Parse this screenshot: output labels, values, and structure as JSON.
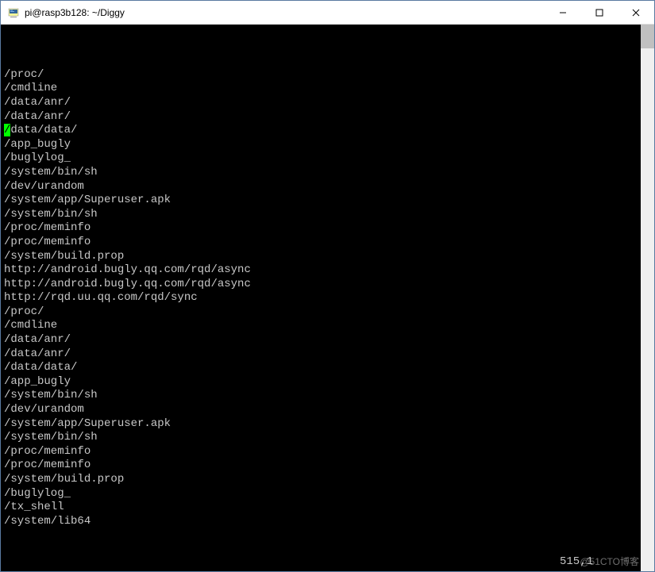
{
  "window": {
    "title": "pi@rasp3b128: ~/Diggy",
    "icon": "putty-icon"
  },
  "terminal": {
    "cursor_line_index": 5,
    "cursor_char": "/",
    "lines": [
      "",
      "/proc/",
      "/cmdline",
      "/data/anr/",
      "/data/anr/",
      "/data/data/",
      "/app_bugly",
      "/buglylog_",
      "/system/bin/sh",
      "/dev/urandom",
      "/system/app/Superuser.apk",
      "/system/bin/sh",
      "/proc/meminfo",
      "/proc/meminfo",
      "/system/build.prop",
      "http://android.bugly.qq.com/rqd/async",
      "http://android.bugly.qq.com/rqd/async",
      "http://rqd.uu.qq.com/rqd/sync",
      "/proc/",
      "/cmdline",
      "/data/anr/",
      "/data/anr/",
      "/data/data/",
      "/app_bugly",
      "/system/bin/sh",
      "/dev/urandom",
      "/system/app/Superuser.apk",
      "/system/bin/sh",
      "/proc/meminfo",
      "/proc/meminfo",
      "/system/build.prop",
      "/buglylog_",
      "/tx_shell",
      "/system/lib64"
    ],
    "status": "515,1"
  },
  "watermark": "@51CTO博客",
  "controls": {
    "minimize": "—",
    "maximize": "□",
    "close": "✕"
  }
}
